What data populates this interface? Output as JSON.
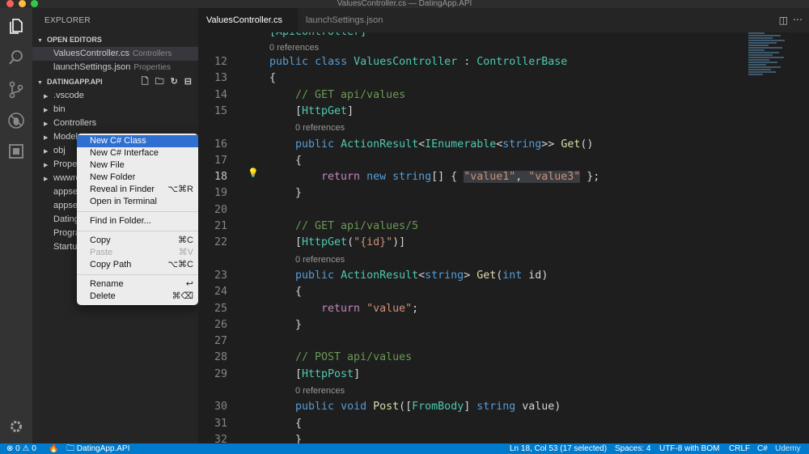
{
  "window": {
    "title": "ValuesController.cs — DatingApp.API"
  },
  "activity_bar": {
    "icons": [
      "files-icon",
      "search-icon",
      "source-control-icon",
      "debug-icon",
      "extensions-icon",
      "settings-gear-icon"
    ]
  },
  "explorer": {
    "title": "EXPLORER",
    "open_editors": {
      "label": "OPEN EDITORS",
      "items": [
        {
          "name": "ValuesController.cs",
          "desc": "Controllers"
        },
        {
          "name": "launchSettings.json",
          "desc": "Properties"
        }
      ]
    },
    "project": {
      "label": "DATINGAPP.API",
      "items": [
        {
          "name": ".vscode",
          "caret": "▶"
        },
        {
          "name": "bin",
          "caret": "▶"
        },
        {
          "name": "Controllers",
          "caret": "▶"
        },
        {
          "name": "Models",
          "caret": "▶"
        },
        {
          "name": "obj",
          "caret": "▶"
        },
        {
          "name": "Properties",
          "caret": "▶"
        },
        {
          "name": "wwwroot",
          "caret": "▶"
        },
        {
          "name": "appsettings.Development.json",
          "caret": ""
        },
        {
          "name": "appsettings.json",
          "caret": ""
        },
        {
          "name": "DatingApp.API.csproj",
          "caret": ""
        },
        {
          "name": "Program.cs",
          "caret": ""
        },
        {
          "name": "Startup.cs",
          "caret": ""
        }
      ]
    }
  },
  "context_menu": {
    "groups": [
      [
        {
          "label": "New C# Class",
          "shortcut": "",
          "highlighted": true
        },
        {
          "label": "New C# Interface",
          "shortcut": ""
        },
        {
          "label": "New File",
          "shortcut": ""
        },
        {
          "label": "New Folder",
          "shortcut": ""
        },
        {
          "label": "Reveal in Finder",
          "shortcut": "⌥⌘R"
        },
        {
          "label": "Open in Terminal",
          "shortcut": ""
        }
      ],
      [
        {
          "label": "Find in Folder...",
          "shortcut": ""
        }
      ],
      [
        {
          "label": "Copy",
          "shortcut": "⌘C"
        },
        {
          "label": "Paste",
          "shortcut": "⌘V",
          "disabled": true
        },
        {
          "label": "Copy Path",
          "shortcut": "⌥⌘C"
        }
      ],
      [
        {
          "label": "Rename",
          "shortcut": "↩"
        },
        {
          "label": "Delete",
          "shortcut": "⌘⌫"
        }
      ]
    ]
  },
  "tabs": [
    {
      "label": "ValuesController.cs",
      "active": true
    },
    {
      "label": "launchSettings.json",
      "active": false
    }
  ],
  "editor": {
    "references_label": "0 references",
    "partial_top": "[ApiController]",
    "lines": [
      {
        "n": "12",
        "code": "public class ValuesController : ControllerBase"
      },
      {
        "n": "13",
        "code": "{"
      },
      {
        "n": "14",
        "code": "// GET api/values"
      },
      {
        "n": "15",
        "code": "[HttpGet]"
      },
      {
        "n": "16",
        "code": "public ActionResult<IEnumerable<string>> Get()"
      },
      {
        "n": "17",
        "code": "{"
      },
      {
        "n": "18",
        "code": "return new string[] { \"value1\", \"value3\" };"
      },
      {
        "n": "19",
        "code": "}"
      },
      {
        "n": "20",
        "code": ""
      },
      {
        "n": "21",
        "code": "// GET api/values/5"
      },
      {
        "n": "22",
        "code": "[HttpGet(\"{id}\")]"
      },
      {
        "n": "23",
        "code": "public ActionResult<string> Get(int id)"
      },
      {
        "n": "24",
        "code": "{"
      },
      {
        "n": "25",
        "code": "return \"value\";"
      },
      {
        "n": "26",
        "code": "}"
      },
      {
        "n": "27",
        "code": ""
      },
      {
        "n": "28",
        "code": "// POST api/values"
      },
      {
        "n": "29",
        "code": "[HttpPost]"
      },
      {
        "n": "30",
        "code": "public void Post([FromBody] string value)"
      },
      {
        "n": "31",
        "code": "{"
      },
      {
        "n": "32",
        "code": "}"
      }
    ],
    "current_line": "18"
  },
  "status_bar": {
    "errors": "0",
    "warnings": "0",
    "project": "DatingApp.API",
    "position": "Ln 18, Col 53 (17 selected)",
    "spaces": "Spaces: 4",
    "encoding": "UTF-8 with BOM",
    "eol": "CRLF",
    "language": "C#",
    "watermark": "Udemy"
  },
  "colors": {
    "accent": "#007acc",
    "menu_highlight": "#2f6fd1"
  }
}
